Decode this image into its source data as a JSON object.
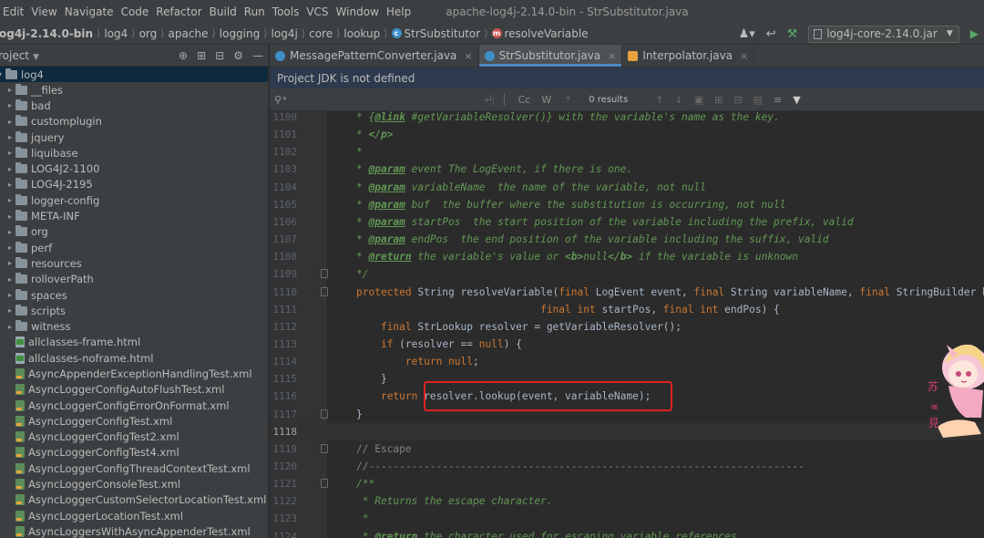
{
  "menu": [
    "Edit",
    "View",
    "Navigate",
    "Code",
    "Refactor",
    "Build",
    "Run",
    "Tools",
    "VCS",
    "Window",
    "Help"
  ],
  "window_title": "apache-log4j-2.14.0-bin - StrSubstitutor.java",
  "breadcrumbs": [
    "og4j-2.14.0-bin",
    "log4",
    "org",
    "apache",
    "logging",
    "log4j",
    "core",
    "lookup",
    "StrSubstitutor",
    "resolveVariable"
  ],
  "run_config": "log4j-core-2.14.0.jar",
  "project": {
    "title": "roject",
    "root": "log4",
    "folders": [
      "__files",
      "bad",
      "customplugin",
      "jquery",
      "liquibase",
      "LOG4J2-1100",
      "LOG4J-2195",
      "logger-config",
      "META-INF",
      "org",
      "perf",
      "resources",
      "rolloverPath",
      "spaces",
      "scripts",
      "witness"
    ],
    "files": [
      {
        "name": "allclasses-frame.html",
        "type": "html"
      },
      {
        "name": "allclasses-noframe.html",
        "type": "html"
      },
      {
        "name": "AsyncAppenderExceptionHandlingTest.xml",
        "type": "xml"
      },
      {
        "name": "AsyncLoggerConfigAutoFlushTest.xml",
        "type": "xml"
      },
      {
        "name": "AsyncLoggerConfigErrorOnFormat.xml",
        "type": "xml"
      },
      {
        "name": "AsyncLoggerConfigTest.xml",
        "type": "xml"
      },
      {
        "name": "AsyncLoggerConfigTest2.xml",
        "type": "xml"
      },
      {
        "name": "AsyncLoggerConfigTest4.xml",
        "type": "xml"
      },
      {
        "name": "AsyncLoggerConfigThreadContextTest.xml",
        "type": "xml"
      },
      {
        "name": "AsyncLoggerConsoleTest.xml",
        "type": "xml"
      },
      {
        "name": "AsyncLoggerCustomSelectorLocationTest.xml",
        "type": "xml"
      },
      {
        "name": "AsyncLoggerLocationTest.xml",
        "type": "xml"
      },
      {
        "name": "AsyncLoggersWithAsyncAppenderTest.xml",
        "type": "xml"
      }
    ]
  },
  "tabs": [
    {
      "label": "MessagePatternConverter.java",
      "active": false
    },
    {
      "label": "StrSubstitutor.java",
      "active": true
    },
    {
      "label": "Interpolator.java",
      "active": false
    }
  ],
  "jdk_notice": "Project JDK is not defined",
  "find": {
    "results": "0 results",
    "cc": "Cc",
    "w": "W",
    "regex": ".*"
  },
  "editor": {
    "current_line": 1118,
    "lines": [
      {
        "n": 1100,
        "html": "<span class=\"c\">* {</span><span class=\"tag\">@link</span><span class=\"c\"> #getVariableResolver()} with the variable's name as the key.</span>"
      },
      {
        "n": 1101,
        "html": "<span class=\"c\">* </span><span class=\"htmltag\">&lt;/p&gt;</span>"
      },
      {
        "n": 1102,
        "html": "<span class=\"c\">*</span>"
      },
      {
        "n": 1103,
        "html": "<span class=\"c\">* </span><span class=\"tag\">@param</span><span class=\"c\"> event The LogEvent, if there is one.</span>"
      },
      {
        "n": 1104,
        "html": "<span class=\"c\">* </span><span class=\"tag\">@param</span><span class=\"c\"> variableName  the name of the variable, not null</span>"
      },
      {
        "n": 1105,
        "html": "<span class=\"c\">* </span><span class=\"tag\">@param</span><span class=\"c\"> buf  the buffer where the substitution is occurring, not null</span>"
      },
      {
        "n": 1106,
        "html": "<span class=\"c\">* </span><span class=\"tag\">@param</span><span class=\"c\"> startPos  the start position of the variable including the prefix, valid</span>"
      },
      {
        "n": 1107,
        "html": "<span class=\"c\">* </span><span class=\"tag\">@param</span><span class=\"c\"> endPos  the end position of the variable including the suffix, valid</span>"
      },
      {
        "n": 1108,
        "html": "<span class=\"c\">* </span><span class=\"tag\">@return</span><span class=\"c\"> the variable's value or </span><span class=\"htmltag\">&lt;b&gt;</span><span class=\"c\">null</span><span class=\"htmltag\">&lt;/b&gt;</span><span class=\"c\"> if the variable is unknown</span>"
      },
      {
        "n": 1109,
        "html": "<span class=\"c\">*/</span>"
      },
      {
        "n": 1110,
        "html": "<span class=\"k\">protected</span> String resolveVariable(<span class=\"k\">final</span> LogEvent event, <span class=\"k\">final</span> String variableName, <span class=\"k\">final</span> StringBuilder buf,"
      },
      {
        "n": 1111,
        "html": "                              <span class=\"k\">final int</span> startPos, <span class=\"k\">final int</span> endPos) {"
      },
      {
        "n": 1112,
        "html": "    <span class=\"k\">final</span> StrLookup resolver = getVariableResolver();"
      },
      {
        "n": 1113,
        "html": "    <span class=\"k\">if</span> (resolver == <span class=\"k\">null</span>) {"
      },
      {
        "n": 1114,
        "html": "        <span class=\"k\">return null</span>;"
      },
      {
        "n": 1115,
        "html": "    }"
      },
      {
        "n": 1116,
        "html": "    <span class=\"k\">return</span> resolver.lookup(event, variableName);"
      },
      {
        "n": 1117,
        "html": "}"
      },
      {
        "n": 1118,
        "html": ""
      },
      {
        "n": 1119,
        "html": "<span class=\"lc\">// Escape</span>"
      },
      {
        "n": 1120,
        "html": "<span class=\"lc\">//-----------------------------------------------------------------------</span>"
      },
      {
        "n": 1121,
        "html": "<span class=\"c\">/**</span>"
      },
      {
        "n": 1122,
        "html": "<span class=\"c\"> * Returns the escape character.</span>"
      },
      {
        "n": 1123,
        "html": "<span class=\"c\"> *</span>"
      },
      {
        "n": 1124,
        "html": "<span class=\"c\"> * </span><span class=\"tag\">@return</span><span class=\"c\"> the character used for escaping variable references</span>"
      }
    ]
  },
  "colors": {
    "accent": "#4a88c7",
    "highlight_box": "#e02020"
  }
}
